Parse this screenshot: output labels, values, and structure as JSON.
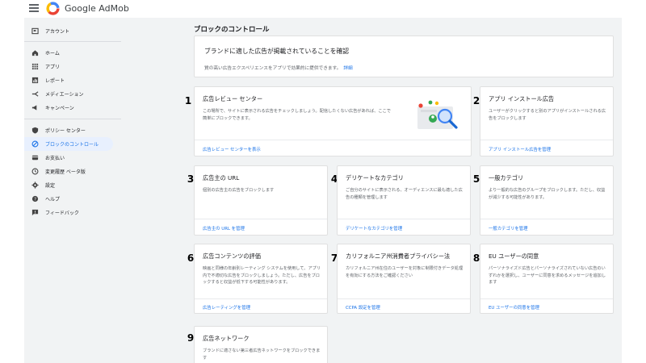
{
  "app": {
    "brand": "Google AdMob"
  },
  "sidebar": {
    "items": [
      {
        "label": "アカウント",
        "icon": "account-icon"
      },
      {
        "label": "ホーム",
        "icon": "home-icon"
      },
      {
        "label": "アプリ",
        "icon": "apps-icon"
      },
      {
        "label": "レポート",
        "icon": "report-icon"
      },
      {
        "label": "メディエーション",
        "icon": "mediation-icon"
      },
      {
        "label": "キャンペーン",
        "icon": "campaign-icon"
      },
      {
        "label": "ポリシー センター",
        "icon": "policy-icon"
      },
      {
        "label": "ブロックのコントロール",
        "icon": "block-icon",
        "active": true
      },
      {
        "label": "お支払い",
        "icon": "payment-icon"
      },
      {
        "label": "変更履歴 ベータ版",
        "icon": "history-icon"
      },
      {
        "label": "設定",
        "icon": "settings-icon"
      },
      {
        "label": "ヘルプ",
        "icon": "help-icon"
      },
      {
        "label": "フィードバック",
        "icon": "feedback-icon"
      }
    ]
  },
  "main": {
    "title": "ブロックのコントロール",
    "banner": {
      "title": "ブランドに適した広告が掲載されていることを確認",
      "text": "質の高い広告エクスペリエンスをアプリで効果的に提供できます。",
      "link": "詳細"
    },
    "cards": [
      {
        "num": "1",
        "title": "広告レビュー センター",
        "desc": "この場所で、サイトに表示される広告をチェックしましょう。配信したくない広告があれば、ここで簡単にブロックできます。",
        "link": "広告レビュー センターを表示"
      },
      {
        "num": "2",
        "title": "アプリ インストール広告",
        "desc": "ユーザーがクリックすると別のアプリがインストールされる広告をブロックします",
        "link": "アプリ インストール広告を管理"
      },
      {
        "num": "3",
        "title": "広告主の URL",
        "desc": "個別の広告主の広告をブロックします",
        "link": "広告主の URL を管理"
      },
      {
        "num": "4",
        "title": "デリケートなカテゴリ",
        "desc": "ご自分のサイトに表示される、オーディエンスに最も適した広告の種類を管理します",
        "link": "デリケートなカテゴリを管理"
      },
      {
        "num": "5",
        "title": "一般カテゴリ",
        "desc": "より一般的な広告のグループをブロックします。ただし、収益が減少する可能性があります。",
        "link": "一般カテゴリを管理"
      },
      {
        "num": "6",
        "title": "広告コンテンツの評価",
        "desc": "映画と同様の年齢別レーティング システムを使用して、アプリ内で不適切な広告をブロックしましょう。ただし、広告をブロックすると収益が低下する可能性があります。",
        "link": "広告レーティングを管理"
      },
      {
        "num": "7",
        "title": "カリフォルニア州消費者プライバシー法",
        "desc": "カリフォルニア州在住のユーザーを対象に制限付きデータ処理を有効にする方法をご確認ください",
        "link": "CCPA 設定を管理"
      },
      {
        "num": "8",
        "title": "EU ユーザーの同意",
        "desc": "パーソナライズド広告とパーソナライズされていない広告のいずれかを選択し、ユーザーに同意を求めるメッセージを追加します",
        "link": "EU ユーザーの同意を管理"
      },
      {
        "num": "9",
        "title": "広告ネットワーク",
        "desc": "ブランドに適さない第三者広告ネットワークをブロックできます",
        "link": ""
      }
    ]
  },
  "colors": {
    "accent": "#1a73e8",
    "background": "#f1f3f4",
    "card": "#ffffff"
  }
}
